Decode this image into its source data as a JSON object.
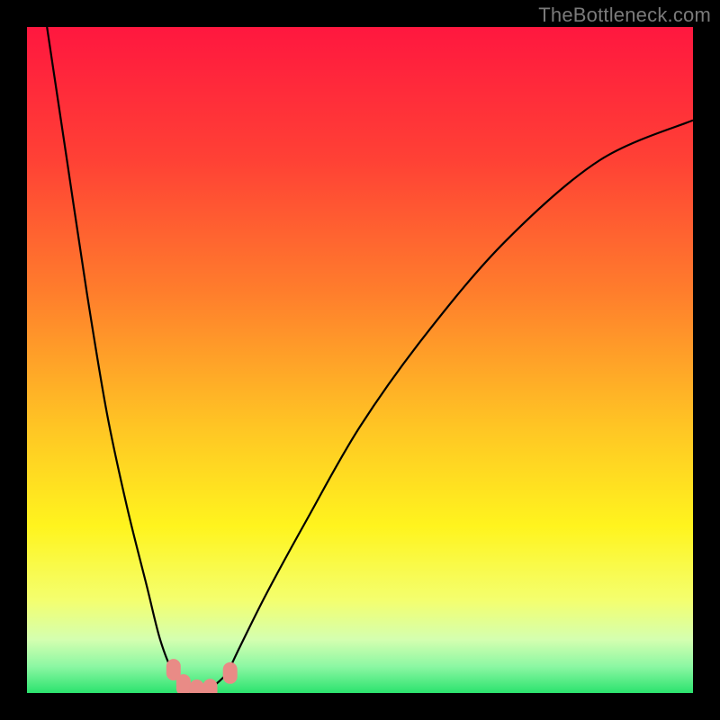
{
  "watermark": "TheBottleneck.com",
  "chart_data": {
    "type": "line",
    "title": "",
    "xlabel": "",
    "ylabel": "",
    "xlim": [
      0,
      100
    ],
    "ylim": [
      0,
      100
    ],
    "grid": false,
    "legend": false,
    "background": {
      "note": "vertical gradient: red (top) → orange → yellow → pale-yellow → green (very bottom)",
      "stops": [
        {
          "pos": 0.0,
          "color": "#ff173f"
        },
        {
          "pos": 0.2,
          "color": "#ff4135"
        },
        {
          "pos": 0.4,
          "color": "#ff7e2c"
        },
        {
          "pos": 0.6,
          "color": "#ffc524"
        },
        {
          "pos": 0.75,
          "color": "#fff41e"
        },
        {
          "pos": 0.86,
          "color": "#f4ff6e"
        },
        {
          "pos": 0.92,
          "color": "#d4ffb0"
        },
        {
          "pos": 0.96,
          "color": "#8cf7a3"
        },
        {
          "pos": 1.0,
          "color": "#2be36e"
        }
      ]
    },
    "series": [
      {
        "name": "bottleneck-curve",
        "stroke": "#000000",
        "x": [
          3,
          6,
          9,
          12,
          15,
          18,
          20,
          22,
          24,
          25,
          26,
          27,
          28,
          30,
          32,
          36,
          42,
          50,
          60,
          72,
          86,
          100
        ],
        "y": [
          100,
          80,
          60,
          42,
          28,
          16,
          8,
          3,
          1,
          0,
          0,
          0,
          1,
          3,
          7,
          15,
          26,
          40,
          54,
          68,
          80,
          86
        ]
      }
    ],
    "markers": {
      "name": "highlight-dots",
      "color": "#e98b86",
      "shape": "rounded-capsule",
      "points": [
        {
          "x": 22.0,
          "y": 3.5
        },
        {
          "x": 23.5,
          "y": 1.2
        },
        {
          "x": 25.5,
          "y": 0.4
        },
        {
          "x": 27.5,
          "y": 0.5
        },
        {
          "x": 30.5,
          "y": 3.0
        }
      ]
    }
  }
}
